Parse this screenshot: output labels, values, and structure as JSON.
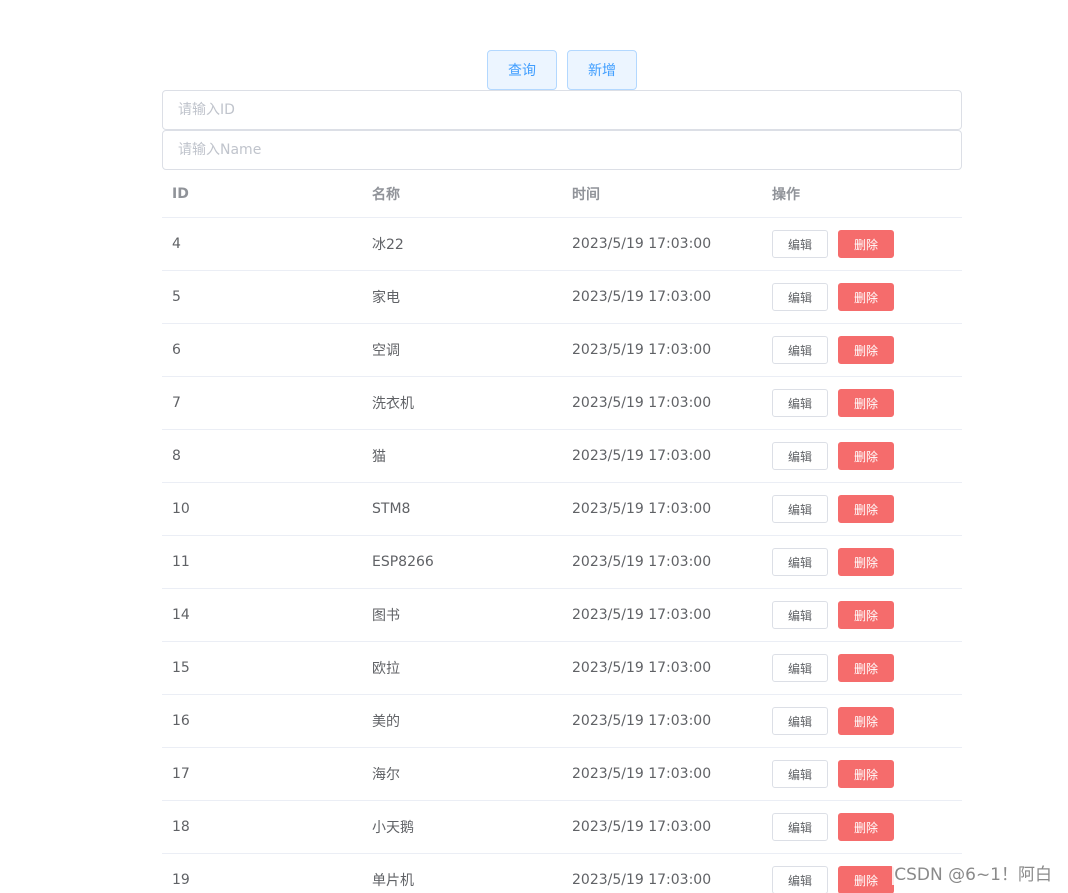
{
  "toolbar": {
    "query_label": "查询",
    "add_label": "新增"
  },
  "filters": {
    "id_placeholder": "请输入ID",
    "name_placeholder": "请输入Name"
  },
  "table": {
    "headers": [
      "ID",
      "名称",
      "时间",
      "操作"
    ],
    "edit_label": "编辑",
    "delete_label": "删除",
    "rows": [
      {
        "id": "4",
        "name": "冰22",
        "time": "2023/5/19 17:03:00"
      },
      {
        "id": "5",
        "name": "家电",
        "time": "2023/5/19 17:03:00"
      },
      {
        "id": "6",
        "name": "空调",
        "time": "2023/5/19 17:03:00"
      },
      {
        "id": "7",
        "name": "洗衣机",
        "time": "2023/5/19 17:03:00"
      },
      {
        "id": "8",
        "name": "猫",
        "time": "2023/5/19 17:03:00"
      },
      {
        "id": "10",
        "name": "STM8",
        "time": "2023/5/19 17:03:00"
      },
      {
        "id": "11",
        "name": "ESP8266",
        "time": "2023/5/19 17:03:00"
      },
      {
        "id": "14",
        "name": "图书",
        "time": "2023/5/19 17:03:00"
      },
      {
        "id": "15",
        "name": "欧拉",
        "time": "2023/5/19 17:03:00"
      },
      {
        "id": "16",
        "name": "美的",
        "time": "2023/5/19 17:03:00"
      },
      {
        "id": "17",
        "name": "海尔",
        "time": "2023/5/19 17:03:00"
      },
      {
        "id": "18",
        "name": "小天鹅",
        "time": "2023/5/19 17:03:00"
      },
      {
        "id": "19",
        "name": "单片机",
        "time": "2023/5/19 17:03:00"
      }
    ]
  },
  "watermark": "CSDN @6~1！阿白",
  "colors": {
    "primary": "#409eff",
    "danger": "#f56c6c",
    "border": "#ebeef5"
  }
}
